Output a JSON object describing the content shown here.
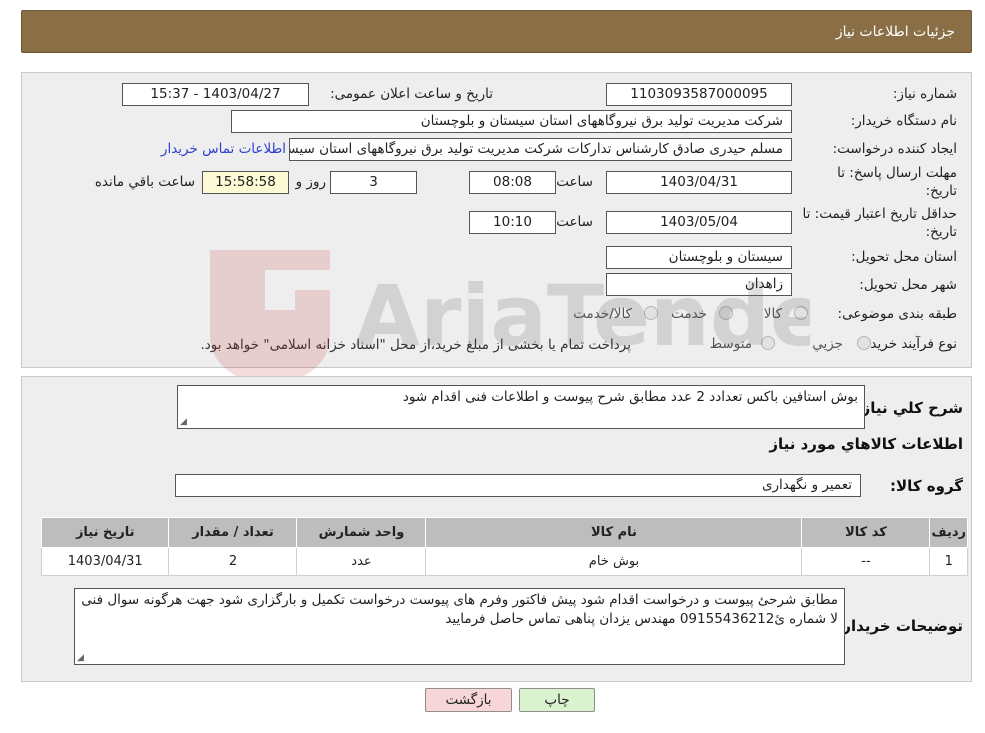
{
  "header": {
    "title": "جزئیات اطلاعات نیاز"
  },
  "form": {
    "need_number_label": "شماره نیاز:",
    "need_number": "1103093587000095",
    "announce_label": "تاریخ و ساعت اعلان عمومی:",
    "announce_value": "1403/04/27 - 15:37",
    "buyer_org_label": "نام دستگاه خریدار:",
    "buyer_org": "شرکت مدیریت تولید برق نیروگاههای استان سیستان و بلوچستان",
    "creator_label": "ایجاد کننده درخواست:",
    "creator": "مسلم حیدری صادق کارشناس تدارکات شرکت مدیریت تولید برق نیروگاههای استان سیستان و بلوچستان",
    "contact_link": "اطلاعات تماس خریدار",
    "deadline_label_1": "مهلت ارسال پاسخ: تا",
    "deadline_label_2": "تاریخ:",
    "deadline_date": "1403/04/31",
    "time_label": "ساعت",
    "deadline_time": "08:08",
    "remaining_days": "3",
    "days_label": "روز و",
    "remaining_time": "15:58:58",
    "remaining_label": "ساعت باقي مانده",
    "validity_label_1": "حداقل تاریخ اعتبار قیمت: تا",
    "validity_label_2": "تاریخ:",
    "validity_date": "1403/05/04",
    "validity_time": "10:10",
    "province_label": "استان محل تحویل:",
    "province": "سیستان و بلوچستان",
    "city_label": "شهر محل تحویل:",
    "city": "زاهدان",
    "category_label": "طبقه بندی موضوعی:",
    "category_options": [
      "کالا",
      "خدمت",
      "کالا/خدمت"
    ],
    "process_label": "نوع فرآیند خرید :",
    "process_options": [
      "جزيي",
      "متوسط"
    ],
    "process_note": "پرداخت تمام یا بخشی از مبلغ خرید،از محل \"اسناد خزانه اسلامی\" خواهد بود."
  },
  "watermark": {
    "text": "AriaTender.neT"
  },
  "details": {
    "summary_label": "شرح کلي نیاز:",
    "summary": "بوش استافین باکس تعدادد 2 عدد  مطابق شرح پیوست و اطلاعات فنی اقدام شود",
    "goods_info_title": "اطلاعات کالاهاي مورد نياز",
    "goods_group_label": "گروه کالا:",
    "goods_group": "تعمیر و نگهداری",
    "table": {
      "columns": [
        "ردیف",
        "کد کالا",
        "نام کالا",
        "واحد شمارش",
        "تعداد / مقدار",
        "تاریخ نیاز"
      ],
      "rows": [
        [
          "1",
          "--",
          "بوش خام",
          "عدد",
          "2",
          "1403/04/31"
        ]
      ]
    },
    "buyer_notes_label": "توضیحات خریدار:",
    "buyer_notes": "مطابق شرحئ پیوست و درخواست اقدام شود پیش فاکتور وفرم های پیوست درخواست تکمیل و بارگزاری شود جهت هرگونه سوال فنی لا شماره ئ09155436212 مهندس یزدان پناهی تماس حاصل فرمایید"
  },
  "buttons": {
    "print": "چاپ",
    "back": "بازگشت"
  }
}
